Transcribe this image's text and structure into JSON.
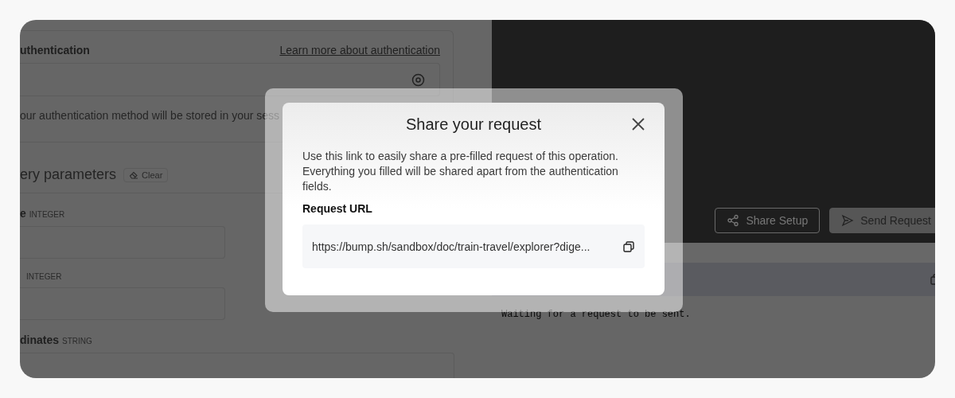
{
  "authentication": {
    "title": "uthentication",
    "link": "Learn more about authentication",
    "helper": "our authentication method will be stored in your sess"
  },
  "query_parameters": {
    "title": "ery parameters",
    "clear_button": "Clear",
    "params": [
      {
        "name": "e",
        "type": "INTEGER",
        "wide": false
      },
      {
        "type": "INTEGER",
        "wide": false
      },
      {
        "name": "dinates",
        "type": "STRING",
        "wide": true
      }
    ]
  },
  "toolbar": {
    "buttons": [
      {
        "label": "Share Setup",
        "kind": "share"
      },
      {
        "label": "Send Request",
        "kind": "send"
      }
    ]
  },
  "response": {
    "message": "Waiting for a request to be sent."
  },
  "modal": {
    "title": "Share your request",
    "description": "Use this link to easily share a pre-filled request of this operation. Everything you filled will be shared apart from the authentication fields.",
    "url_label": "Request URL",
    "url": "https://bump.sh/sandbox/doc/train-travel/explorer?dige..."
  }
}
